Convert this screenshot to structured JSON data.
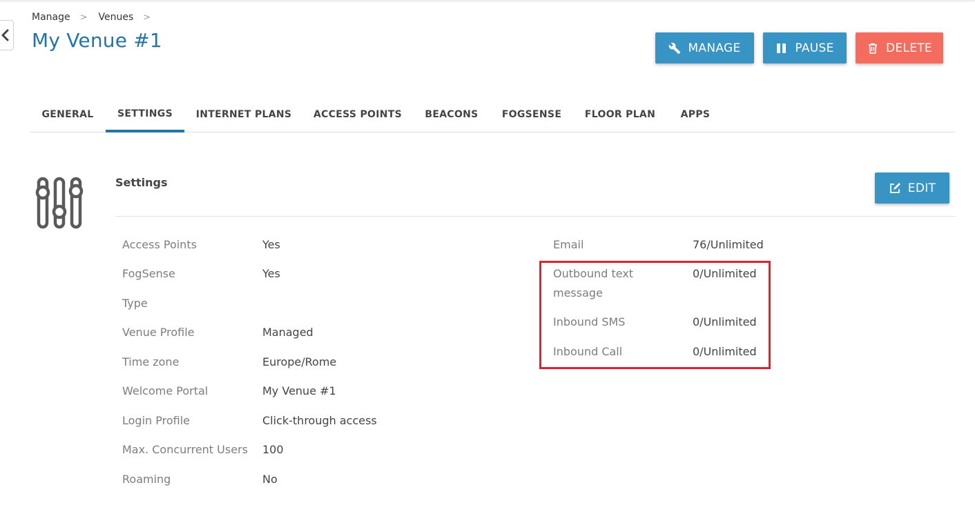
{
  "breadcrumb": {
    "items": [
      "Manage",
      "Venues"
    ],
    "separator": ">"
  },
  "page": {
    "title": "My Venue #1"
  },
  "actions": {
    "manage_label": "MANAGE",
    "pause_label": "PAUSE",
    "delete_label": "DELETE",
    "edit_label": "EDIT"
  },
  "tabs": [
    {
      "label": "GENERAL",
      "active": false
    },
    {
      "label": "SETTINGS",
      "active": true
    },
    {
      "label": "INTERNET PLANS",
      "active": false
    },
    {
      "label": "ACCESS POINTS",
      "active": false
    },
    {
      "label": "BEACONS",
      "active": false
    },
    {
      "label": "FOGSENSE",
      "active": false
    },
    {
      "label": "FLOOR PLAN",
      "active": false
    },
    {
      "label": "APPS",
      "active": false
    }
  ],
  "settings": {
    "title": "Settings",
    "left": [
      {
        "label": "Access Points",
        "value": "Yes"
      },
      {
        "label": "FogSense",
        "value": "Yes"
      },
      {
        "label": "Type",
        "value": ""
      },
      {
        "label": "Venue Profile",
        "value": "Managed"
      },
      {
        "label": "Time zone",
        "value": "Europe/Rome"
      },
      {
        "label": "Welcome Portal",
        "value": "My Venue #1"
      },
      {
        "label": "Login Profile",
        "value": "Click-through access"
      },
      {
        "label": "Max. Concurrent Users",
        "value": "100"
      },
      {
        "label": "Roaming",
        "value": "No"
      }
    ],
    "right": [
      {
        "label": "Email",
        "value": "76/Unlimited"
      },
      {
        "label": "Outbound text message",
        "value": "0/Unlimited"
      },
      {
        "label": "Inbound SMS",
        "value": "0/Unlimited"
      },
      {
        "label": "Inbound Call",
        "value": "0/Unlimited"
      }
    ]
  },
  "colors": {
    "primary": "#3794c5",
    "danger": "#f46c5e",
    "title": "#2175a8",
    "highlight": "#e0202a"
  },
  "icons": [
    "chevron-left-icon",
    "wrench-icon",
    "pause-icon",
    "trash-icon",
    "edit-icon",
    "sliders-icon"
  ]
}
